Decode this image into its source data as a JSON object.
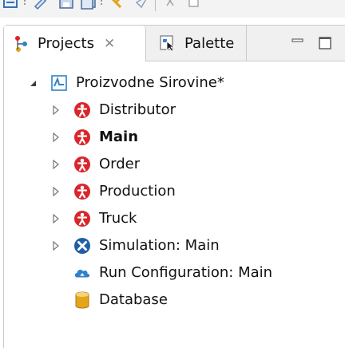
{
  "colors": {
    "agent_red": "#d9262b",
    "simulation_blue": "#1f5ea8",
    "cloud_blue": "#2f82c8",
    "db_yellow": "#e3a51a",
    "border": "#c6cbd2"
  },
  "toolbar": {
    "icons": [
      "run-icon",
      "pencil-icon",
      "save-icon",
      "save-all-icon",
      "build-icon",
      "pin-icon",
      "cut-icon",
      "copy-icon"
    ]
  },
  "view": {
    "tabs": [
      {
        "label": "Projects",
        "close": "✕",
        "icon": "projects-icon",
        "active": true
      },
      {
        "label": "Palette",
        "icon": "palette-icon",
        "active": false
      }
    ],
    "controls": [
      "minimize-icon",
      "maximize-icon"
    ]
  },
  "tree": {
    "project": {
      "label": "Proizvodne Sirovine*",
      "expanded": true,
      "icon": "model-icon"
    },
    "items": [
      {
        "label": "Distributor",
        "icon": "agent-icon",
        "bold": false,
        "expandable": true
      },
      {
        "label": "Main",
        "icon": "agent-icon",
        "bold": true,
        "expandable": true
      },
      {
        "label": "Order",
        "icon": "agent-icon",
        "bold": false,
        "expandable": true
      },
      {
        "label": "Production",
        "icon": "agent-icon",
        "bold": false,
        "expandable": true
      },
      {
        "label": "Truck",
        "icon": "agent-icon",
        "bold": false,
        "expandable": true
      },
      {
        "label": "Simulation: Main",
        "icon": "simulation-icon",
        "bold": false,
        "expandable": true
      },
      {
        "label": "Run Configuration: Main",
        "icon": "cloud-icon",
        "bold": false,
        "expandable": false
      },
      {
        "label": "Database",
        "icon": "database-icon",
        "bold": false,
        "expandable": false
      }
    ]
  }
}
